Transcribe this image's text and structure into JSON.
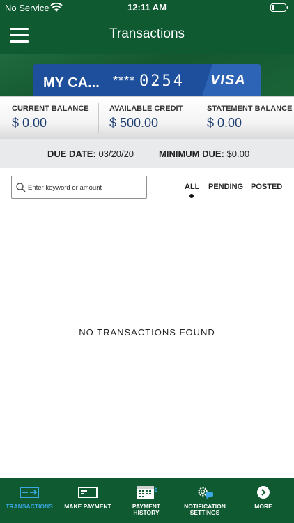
{
  "status_bar": {
    "carrier": "No Service",
    "time": "12:11 AM"
  },
  "header": {
    "title": "Transactions"
  },
  "card": {
    "name": "MY CA...",
    "mask": "****",
    "last_digits": "0254",
    "network": "VISA"
  },
  "balances": [
    {
      "label": "CURRENT BALANCE",
      "value": "$ 0.00"
    },
    {
      "label": "AVAILABLE CREDIT",
      "value": "$ 500.00"
    },
    {
      "label": "STATEMENT BALANCE",
      "value": "$ 0.00"
    }
  ],
  "due": {
    "due_date_label": "DUE DATE:",
    "due_date_value": "03/20/20",
    "minimum_due_label": "MINIMUM DUE:",
    "minimum_due_value": "$0.00"
  },
  "search": {
    "placeholder": "Enter keyword or amount"
  },
  "filters": [
    {
      "label": "ALL",
      "selected": true
    },
    {
      "label": "PENDING",
      "selected": false
    },
    {
      "label": "POSTED",
      "selected": false
    }
  ],
  "empty_message": "NO TRANSACTIONS FOUND",
  "bottom_nav": [
    {
      "label": "TRANSACTIONS",
      "icon": "transactions-icon",
      "active": true
    },
    {
      "label": "MAKE PAYMENT",
      "icon": "payment-card-icon",
      "active": false
    },
    {
      "label": "PAYMENT\nHISTORY",
      "icon": "calendar-icon",
      "active": false
    },
    {
      "label": "NOTIFICATION\nSETTINGS",
      "icon": "gear-chat-icon",
      "active": false
    },
    {
      "label": "MORE",
      "icon": "chevron-right-circle-icon",
      "active": false
    }
  ],
  "colors": {
    "header_green": "#0f5a31",
    "card_blue": "#1d4f9c",
    "balance_blue": "#1f3f73",
    "active_nav": "#3aa8e3"
  }
}
